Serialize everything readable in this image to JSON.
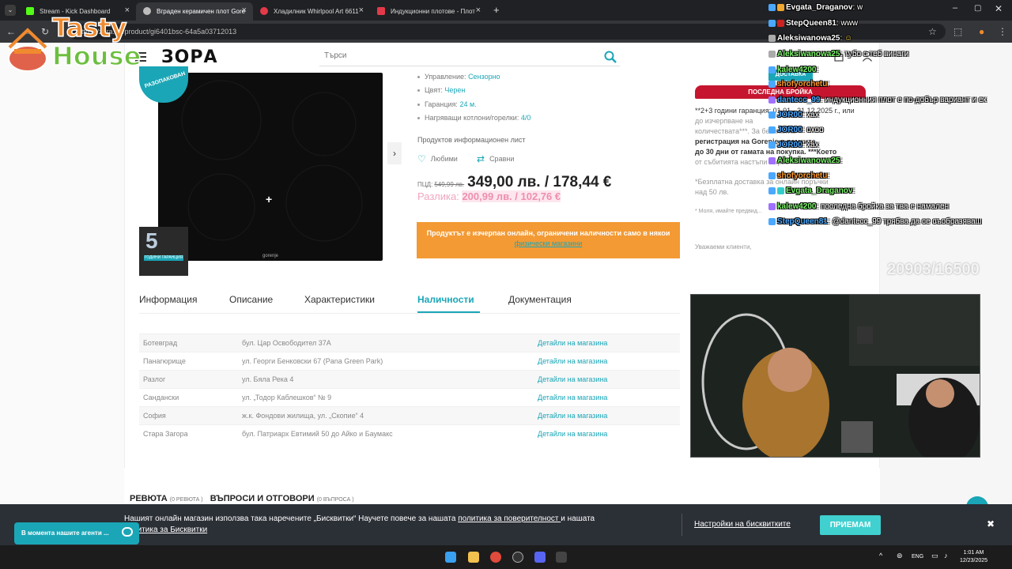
{
  "browser": {
    "tabs": [
      {
        "label": "Stream - Kick Dashboard",
        "color": "#53fc18"
      },
      {
        "label": "Вграден керамичен плот Gore",
        "color": "#bdbdbd"
      },
      {
        "label": "Хладилник Whirlpool Art 6611",
        "color": "#e33a4a"
      },
      {
        "label": "Индукционни плотове - Плот",
        "color": "#e33a4a"
      }
    ],
    "url": "https://zora.bg/product/gi6401bsc-64a5a03712013"
  },
  "header": {
    "logo": "ЗОРА",
    "search_placeholder": "Търси"
  },
  "product": {
    "badge_unpacked": "РАЗОПАКОВАН",
    "warranty_years": "5",
    "warranty_text": "ГОДИНИ ГАРАНЦИЯ",
    "specs": [
      {
        "label": "Управление:",
        "value": "Сензорно"
      },
      {
        "label": "Цвят:",
        "value": "Черен"
      },
      {
        "label": "Гаранция:",
        "value": "24 м."
      },
      {
        "label": "Нагряващи котлони/горелки:",
        "value": "4/0"
      }
    ],
    "datasheet": "Продуктов информационен лист",
    "favorites": "Любими",
    "compare": "Сравни",
    "price_label": "ПЦД:",
    "old_price": "549,99 лв.",
    "new_price": "349,00 лв. / 178,44 €",
    "diff_label": "Разлика:",
    "diff_value": "200,99 лв. / 102,76 €",
    "notice_text": "Продуктът е изчерпан онлайн, ограничени наличности само в някои",
    "notice_link": "физически магазини"
  },
  "right_column": {
    "last_piece": "ПОСЛЕДНА БРОЙКА",
    "delivery_badge": "ДОСТАВКА",
    "promo_line1": "**2+3 години гаранция: 01.01 - 31.12.2025 г., или",
    "promo_line2": "до изчерпване на",
    "promo_line3": "количествата***. За безплатна",
    "promo_line4": "регистрация на Gorenje в рамките",
    "promo_line5": "до 30 дни от гамата на покупка. ***Което",
    "promo_line6": "от събитията настъпи първо",
    "delivery_line1": "*Безплатна доставка за онлайн поръчки",
    "delivery_line2": "над 50 лв.",
    "note": "* Моля, имайте предвид...",
    "dear": "Уважаеми клиенти,"
  },
  "tabs": [
    "Информация",
    "Описание",
    "Характеристики",
    "Наличности",
    "Документация"
  ],
  "stores": [
    {
      "city": "Ботевград",
      "address": "бул. Цар Освободител 37А",
      "link": "Детайли на магазина"
    },
    {
      "city": "Панагюрище",
      "address": "ул. Георги Бенковски 67 (Pana Green Park)",
      "link": "Детайли на магазина"
    },
    {
      "city": "Разлог",
      "address": "ул. Бяла Река 4",
      "link": "Детайли на магазина"
    },
    {
      "city": "Сандански",
      "address": "ул. „Тодор Каблешков“ № 9",
      "link": "Детайли на магазина"
    },
    {
      "city": "София",
      "address": "ж.к. Фондови жилища, ул. „Скопие“ 4",
      "link": "Детайли на магазина"
    },
    {
      "city": "Стара Загора",
      "address": "бул. Патриарх Евтимий 50 до Айко и Баумакс",
      "link": "Детайли на магазина"
    }
  ],
  "reviews": {
    "reviews_title": "РЕВЮТА",
    "reviews_count": "(0 РЕВЮТА )",
    "qa_title": "ВЪПРОСИ И ОТГОВОРИ",
    "qa_count": "(0 ВЪПРОСА )"
  },
  "cookie": {
    "text_a": "Нашият онлайн магазин използва така наречените „Бисквитки“ Научете повече за нашата ",
    "link_a": "политика за поверителност ",
    "text_b": "и нашата",
    "link_b": "политика за Бисквитки",
    "settings": "Настройки на бисквитките",
    "accept": "ПРИЕМАМ"
  },
  "agent_chat": "В момента нашите агенти ...",
  "stream_overlay": {
    "logo_line1": "Tasty",
    "logo_line2": "House",
    "score": "20903/16500",
    "chat": [
      {
        "user": "Evgata_Draganov",
        "msg": ": w",
        "color": "#ffffff"
      },
      {
        "user": "StepQueen81",
        "msg": ": www",
        "color": "#ffffff"
      },
      {
        "user": "Aleksiwanowa25",
        "msg": ":",
        "color": "#ffffff"
      },
      {
        "user": "Aleksiwanowa25",
        "msg": ": тубо с теб винаги",
        "color": "#7cf56a"
      },
      {
        "user": "kalew4200",
        "msg": ":",
        "color": "#7cf56a"
      },
      {
        "user": "shofyorchetu",
        "msg": ":",
        "color": "#ff9a2e"
      },
      {
        "user": "dantecc_99",
        "msg": ": индукционния плот е по-добър вариант и ек",
        "color": "#4aa8ff"
      },
      {
        "user": "JOR00",
        "msg": ": хах",
        "color": "#4aa8ff"
      },
      {
        "user": "JOR00",
        "msg": ": охоо",
        "color": "#4aa8ff"
      },
      {
        "user": "JOR00",
        "msg": ": хах",
        "color": "#4aa8ff"
      },
      {
        "user": "Aleksiwanowa25",
        "msg": ":",
        "color": "#7cf56a"
      },
      {
        "user": "shofyorchetu",
        "msg": ":",
        "color": "#ff9a2e"
      },
      {
        "user": "Evgata_Draganov",
        "msg": ":",
        "color": "#7cf56a"
      },
      {
        "user": "kalew4200",
        "msg": ": последна бройка за тва е намален",
        "color": "#7cf56a"
      },
      {
        "user": "StepQueen81",
        "msg": ": @dantecc_99 трябва да се съобразяваш",
        "color": "#4aa8ff"
      }
    ]
  },
  "taskbar": {
    "lang": "ENG",
    "time": "1:01 AM",
    "date": "12/23/2025"
  }
}
